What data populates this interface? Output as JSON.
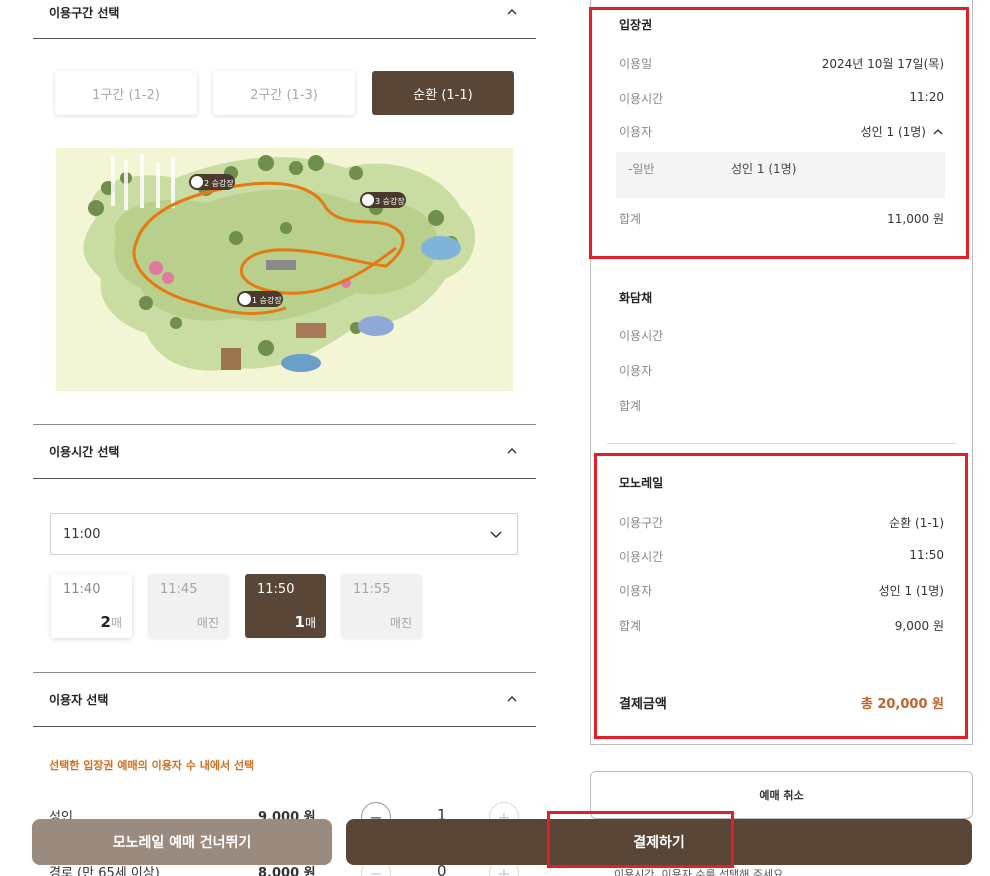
{
  "route_section": {
    "title": "이용구간 선택",
    "options": [
      {
        "label": "1구간 (1-2)",
        "active": false
      },
      {
        "label": "2구간 (1-3)",
        "active": false
      },
      {
        "label": "순환 (1-1)",
        "active": true
      }
    ],
    "map_labels": {
      "station1": "1 승강장",
      "station2": "2 승강장",
      "station3": "3 승강장"
    }
  },
  "time_section": {
    "title": "이용시간 선택",
    "selected_hour": "11:00",
    "slots": [
      {
        "time": "11:40",
        "count": "2",
        "unit": "매",
        "status": "available"
      },
      {
        "time": "11:45",
        "status_label": "매진",
        "status": "soldout"
      },
      {
        "time": "11:50",
        "count": "1",
        "unit": "매",
        "status": "selected"
      },
      {
        "time": "11:55",
        "status_label": "매진",
        "status": "soldout"
      }
    ]
  },
  "user_section": {
    "title": "이용자 선택",
    "notice": "선택한 입장권 예매의 이용자 수 내에서 선택",
    "rows": [
      {
        "label": "성인",
        "price": "9,000 원",
        "qty": "1"
      },
      {
        "label": "경로 (만 65세 이상)",
        "price": "8,000 원",
        "qty": "0"
      }
    ]
  },
  "summary": {
    "ticket": {
      "title": "입장권",
      "date_label": "이용일",
      "date_value": "2024년 10월 17일(목)",
      "time_label": "이용시간",
      "time_value": "11:20",
      "user_label": "이용자",
      "user_value": "성인 1 (1명)",
      "detail_label": "-일반",
      "detail_value": "성인 1 (1명)",
      "total_label": "합계",
      "total_value": "11,000 원"
    },
    "hwadamchae": {
      "title": "화담채",
      "time_label": "이용시간",
      "user_label": "이용자",
      "total_label": "합계"
    },
    "monorail": {
      "title": "모노레일",
      "route_label": "이용구간",
      "route_value": "순환 (1-1)",
      "time_label": "이용시간",
      "time_value": "11:50",
      "user_label": "이용자",
      "user_value": "성인 1 (1명)",
      "total_label": "합계",
      "total_value": "9,000 원"
    },
    "payment_label": "결제금액",
    "payment_value": "총 20,000 원"
  },
  "actions": {
    "cancel": "예매 취소",
    "skip": "모노레일 예매 건너뛰기",
    "pay": "결제하기",
    "hint": "이용시간, 이용자 수를 선택해 주세요"
  },
  "colors": {
    "brand_brown": "#5a4636",
    "muted_brown": "#9b8b7e",
    "accent_orange": "#c0622b",
    "highlight_red": "#e21f26"
  }
}
